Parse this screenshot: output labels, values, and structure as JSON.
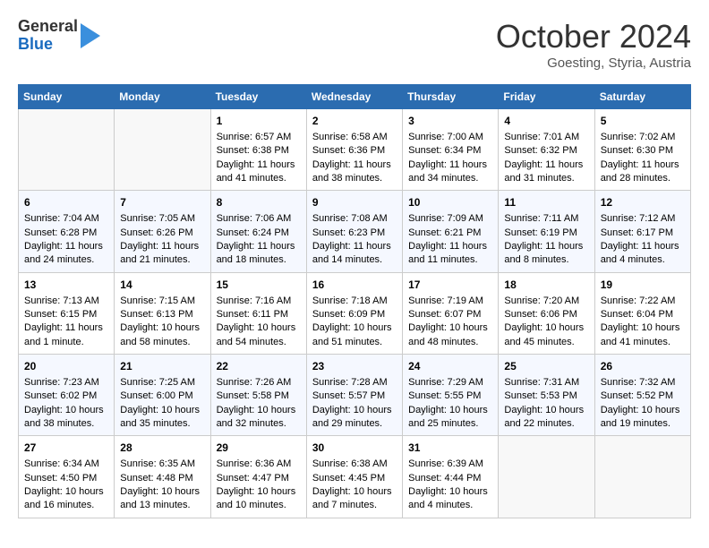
{
  "header": {
    "logo_line1": "General",
    "logo_line2": "Blue",
    "month": "October 2024",
    "location": "Goesting, Styria, Austria"
  },
  "weekdays": [
    "Sunday",
    "Monday",
    "Tuesday",
    "Wednesday",
    "Thursday",
    "Friday",
    "Saturday"
  ],
  "rows": [
    [
      {
        "day": "",
        "info": ""
      },
      {
        "day": "",
        "info": ""
      },
      {
        "day": "1",
        "info": "Sunrise: 6:57 AM\nSunset: 6:38 PM\nDaylight: 11 hours and 41 minutes."
      },
      {
        "day": "2",
        "info": "Sunrise: 6:58 AM\nSunset: 6:36 PM\nDaylight: 11 hours and 38 minutes."
      },
      {
        "day": "3",
        "info": "Sunrise: 7:00 AM\nSunset: 6:34 PM\nDaylight: 11 hours and 34 minutes."
      },
      {
        "day": "4",
        "info": "Sunrise: 7:01 AM\nSunset: 6:32 PM\nDaylight: 11 hours and 31 minutes."
      },
      {
        "day": "5",
        "info": "Sunrise: 7:02 AM\nSunset: 6:30 PM\nDaylight: 11 hours and 28 minutes."
      }
    ],
    [
      {
        "day": "6",
        "info": "Sunrise: 7:04 AM\nSunset: 6:28 PM\nDaylight: 11 hours and 24 minutes."
      },
      {
        "day": "7",
        "info": "Sunrise: 7:05 AM\nSunset: 6:26 PM\nDaylight: 11 hours and 21 minutes."
      },
      {
        "day": "8",
        "info": "Sunrise: 7:06 AM\nSunset: 6:24 PM\nDaylight: 11 hours and 18 minutes."
      },
      {
        "day": "9",
        "info": "Sunrise: 7:08 AM\nSunset: 6:23 PM\nDaylight: 11 hours and 14 minutes."
      },
      {
        "day": "10",
        "info": "Sunrise: 7:09 AM\nSunset: 6:21 PM\nDaylight: 11 hours and 11 minutes."
      },
      {
        "day": "11",
        "info": "Sunrise: 7:11 AM\nSunset: 6:19 PM\nDaylight: 11 hours and 8 minutes."
      },
      {
        "day": "12",
        "info": "Sunrise: 7:12 AM\nSunset: 6:17 PM\nDaylight: 11 hours and 4 minutes."
      }
    ],
    [
      {
        "day": "13",
        "info": "Sunrise: 7:13 AM\nSunset: 6:15 PM\nDaylight: 11 hours and 1 minute."
      },
      {
        "day": "14",
        "info": "Sunrise: 7:15 AM\nSunset: 6:13 PM\nDaylight: 10 hours and 58 minutes."
      },
      {
        "day": "15",
        "info": "Sunrise: 7:16 AM\nSunset: 6:11 PM\nDaylight: 10 hours and 54 minutes."
      },
      {
        "day": "16",
        "info": "Sunrise: 7:18 AM\nSunset: 6:09 PM\nDaylight: 10 hours and 51 minutes."
      },
      {
        "day": "17",
        "info": "Sunrise: 7:19 AM\nSunset: 6:07 PM\nDaylight: 10 hours and 48 minutes."
      },
      {
        "day": "18",
        "info": "Sunrise: 7:20 AM\nSunset: 6:06 PM\nDaylight: 10 hours and 45 minutes."
      },
      {
        "day": "19",
        "info": "Sunrise: 7:22 AM\nSunset: 6:04 PM\nDaylight: 10 hours and 41 minutes."
      }
    ],
    [
      {
        "day": "20",
        "info": "Sunrise: 7:23 AM\nSunset: 6:02 PM\nDaylight: 10 hours and 38 minutes."
      },
      {
        "day": "21",
        "info": "Sunrise: 7:25 AM\nSunset: 6:00 PM\nDaylight: 10 hours and 35 minutes."
      },
      {
        "day": "22",
        "info": "Sunrise: 7:26 AM\nSunset: 5:58 PM\nDaylight: 10 hours and 32 minutes."
      },
      {
        "day": "23",
        "info": "Sunrise: 7:28 AM\nSunset: 5:57 PM\nDaylight: 10 hours and 29 minutes."
      },
      {
        "day": "24",
        "info": "Sunrise: 7:29 AM\nSunset: 5:55 PM\nDaylight: 10 hours and 25 minutes."
      },
      {
        "day": "25",
        "info": "Sunrise: 7:31 AM\nSunset: 5:53 PM\nDaylight: 10 hours and 22 minutes."
      },
      {
        "day": "26",
        "info": "Sunrise: 7:32 AM\nSunset: 5:52 PM\nDaylight: 10 hours and 19 minutes."
      }
    ],
    [
      {
        "day": "27",
        "info": "Sunrise: 6:34 AM\nSunset: 4:50 PM\nDaylight: 10 hours and 16 minutes."
      },
      {
        "day": "28",
        "info": "Sunrise: 6:35 AM\nSunset: 4:48 PM\nDaylight: 10 hours and 13 minutes."
      },
      {
        "day": "29",
        "info": "Sunrise: 6:36 AM\nSunset: 4:47 PM\nDaylight: 10 hours and 10 minutes."
      },
      {
        "day": "30",
        "info": "Sunrise: 6:38 AM\nSunset: 4:45 PM\nDaylight: 10 hours and 7 minutes."
      },
      {
        "day": "31",
        "info": "Sunrise: 6:39 AM\nSunset: 4:44 PM\nDaylight: 10 hours and 4 minutes."
      },
      {
        "day": "",
        "info": ""
      },
      {
        "day": "",
        "info": ""
      }
    ]
  ]
}
